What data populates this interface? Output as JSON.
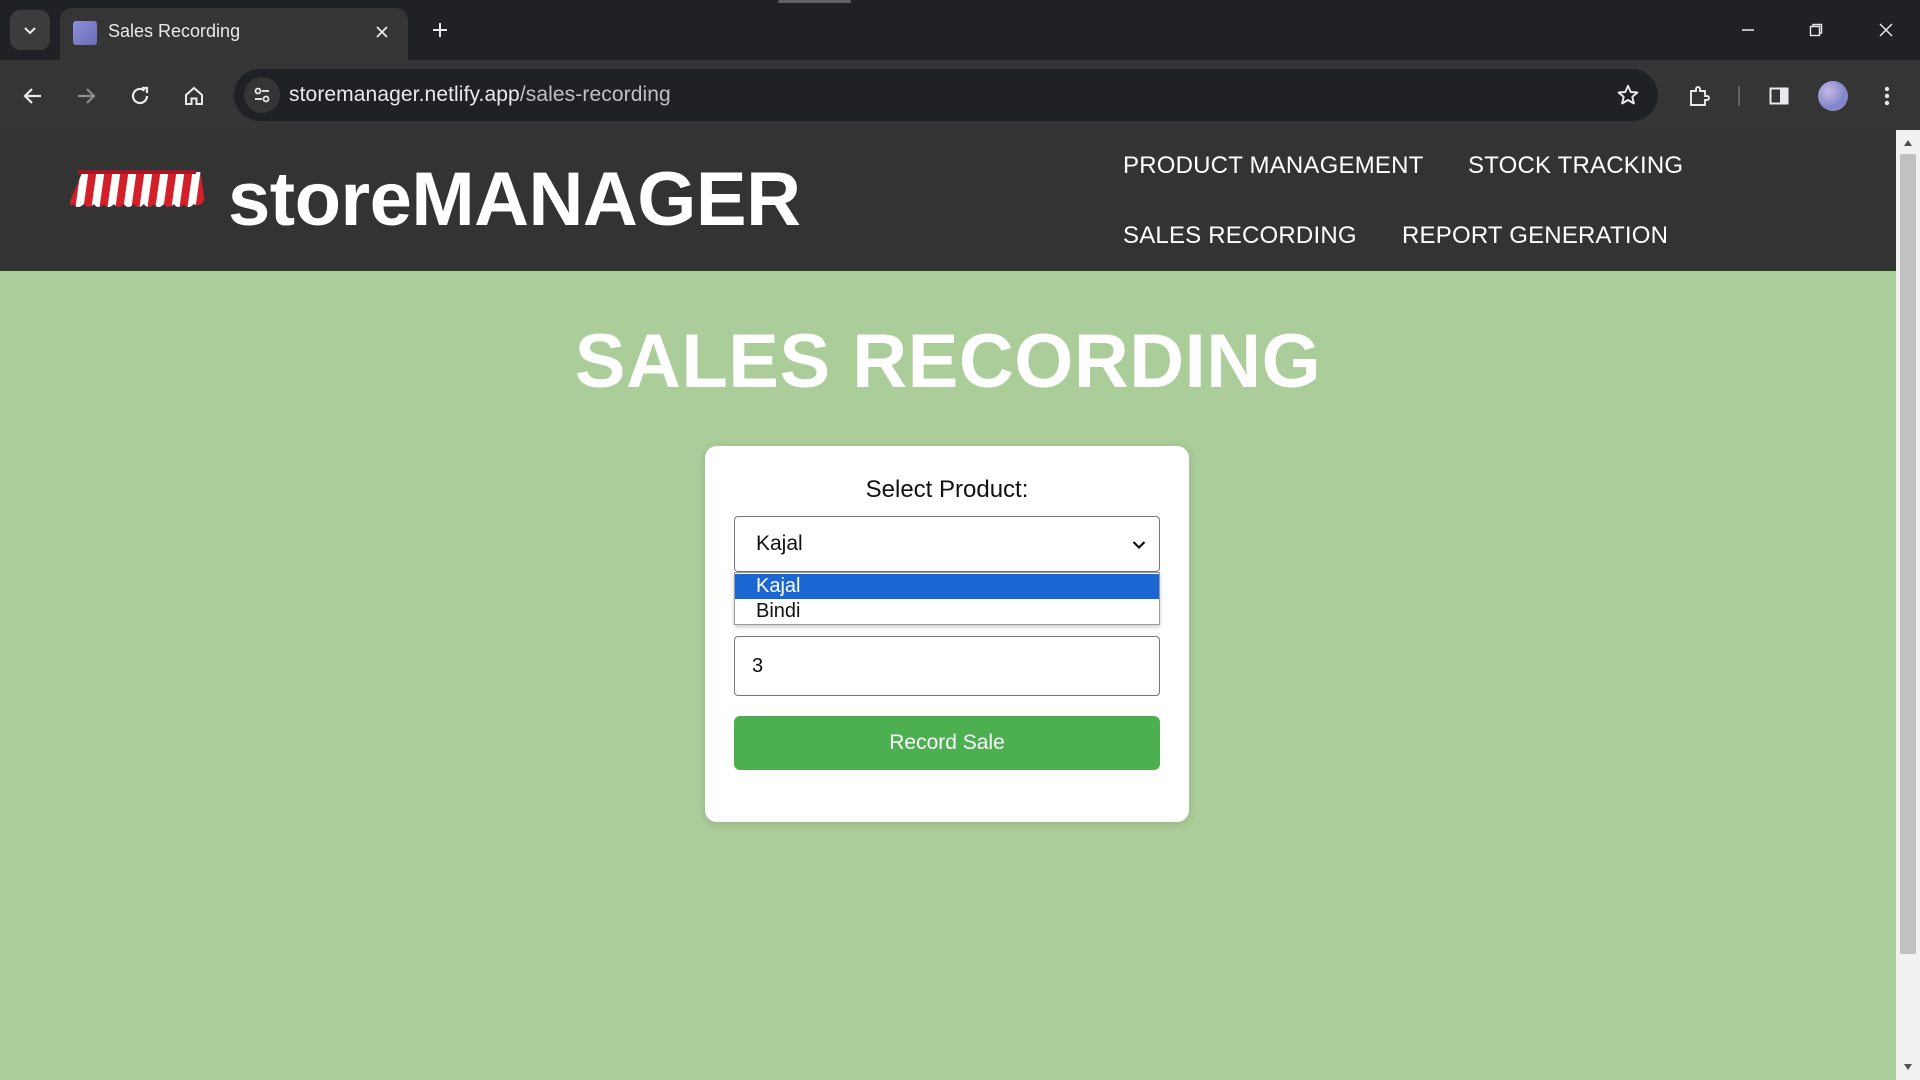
{
  "browser": {
    "tab_title": "Sales Recording",
    "url_host": "storemanager.netlify.app",
    "url_path": "/sales-recording"
  },
  "header": {
    "brand": "storeMANAGER",
    "nav": {
      "product_management": "PRODUCT MANAGEMENT",
      "stock_tracking": "STOCK TRACKING",
      "sales_recording": "SALES RECORDING",
      "report_generation": "REPORT GENERATION"
    }
  },
  "main": {
    "title": "SALES RECORDING",
    "form": {
      "select_label": "Select Product:",
      "selected_product": "Kajal",
      "options": [
        "Kajal",
        "Bindi"
      ],
      "quantity_value": "3",
      "submit_label": "Record Sale"
    }
  },
  "colors": {
    "page_background": "#abcd9a",
    "header_background": "#333333",
    "button_green": "#4caf50",
    "option_highlight": "#1a66d2"
  }
}
